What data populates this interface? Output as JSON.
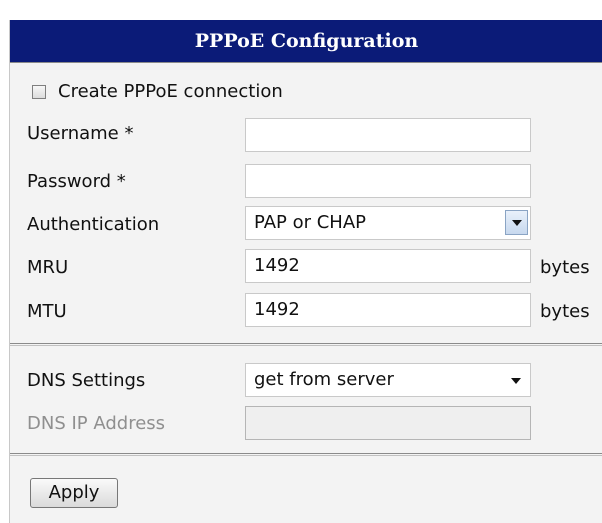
{
  "header": {
    "title": "PPPoE Configuration"
  },
  "create_connection": {
    "label": "Create PPPoE connection",
    "checked": false
  },
  "fields": {
    "username": {
      "label": "Username *",
      "value": ""
    },
    "password": {
      "label": "Password *",
      "value": ""
    },
    "authentication": {
      "label": "Authentication",
      "value": "PAP or CHAP"
    },
    "mru": {
      "label": "MRU",
      "value": "1492",
      "unit": "bytes"
    },
    "mtu": {
      "label": "MTU",
      "value": "1492",
      "unit": "bytes"
    }
  },
  "dns": {
    "settings": {
      "label": "DNS Settings",
      "value": "get from server"
    },
    "ip_address": {
      "label": "DNS IP Address",
      "value": "",
      "disabled": true
    }
  },
  "actions": {
    "apply_label": "Apply"
  },
  "colors": {
    "header_bg": "#0b1b78",
    "panel_bg": "#f3f3f3"
  }
}
